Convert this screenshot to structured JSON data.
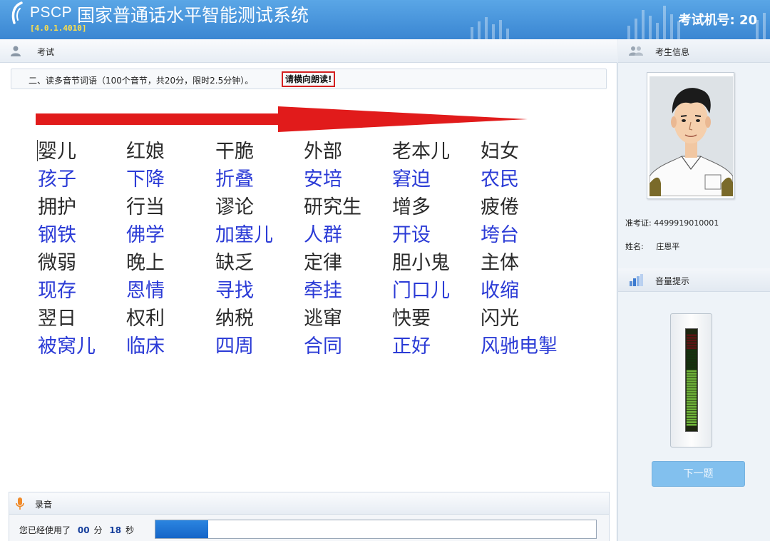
{
  "header": {
    "logo_text": "PSCP",
    "title": "国家普通话水平智能测试系统",
    "version": "[4.0.1.4010]",
    "machine_label": "考试机号: 20"
  },
  "exam": {
    "section_label": "考试",
    "instruction": "二、读多音节词语（100个音节，共20分，限时2.5分钟）。",
    "instruction_highlight": "请横向朗读!",
    "rows": [
      [
        "婴儿",
        "红娘",
        "干脆",
        "外部",
        "老本儿",
        "妇女"
      ],
      [
        "孩子",
        "下降",
        "折叠",
        "安培",
        "窘迫",
        "农民"
      ],
      [
        "拥护",
        "行当",
        "谬论",
        "研究生",
        "增多",
        "疲倦"
      ],
      [
        "钢铁",
        "佛学",
        "加塞儿",
        "人群",
        "开设",
        "垮台"
      ],
      [
        "微弱",
        "晚上",
        "缺乏",
        "定律",
        "胆小鬼",
        "主体"
      ],
      [
        "现存",
        "恩情",
        "寻找",
        "牵挂",
        "门口儿",
        "收缩"
      ],
      [
        "翌日",
        "权利",
        "纳税",
        "逃窜",
        "快要",
        "闪光"
      ],
      [
        "被窝儿",
        "临床",
        "四周",
        "合同",
        "正好",
        "风驰电掣"
      ]
    ],
    "colors": {
      "odd_row": "#2a2a2a",
      "even_row": "#2b3bd6",
      "arrow": "#e11b1b"
    }
  },
  "recording": {
    "label": "录音",
    "used_prefix": "您已经使用了",
    "minutes": "00",
    "minute_unit": "分",
    "seconds": "18",
    "second_unit": "秒",
    "progress": 0.12
  },
  "candidate": {
    "section_label": "考生信息",
    "ticket_label": "准考证:",
    "ticket_number": "4499919010001",
    "name_label": "姓名:",
    "name": "庄恩平"
  },
  "volume": {
    "section_label": "音量提示",
    "level": 0.62
  },
  "next_button": "下一题"
}
